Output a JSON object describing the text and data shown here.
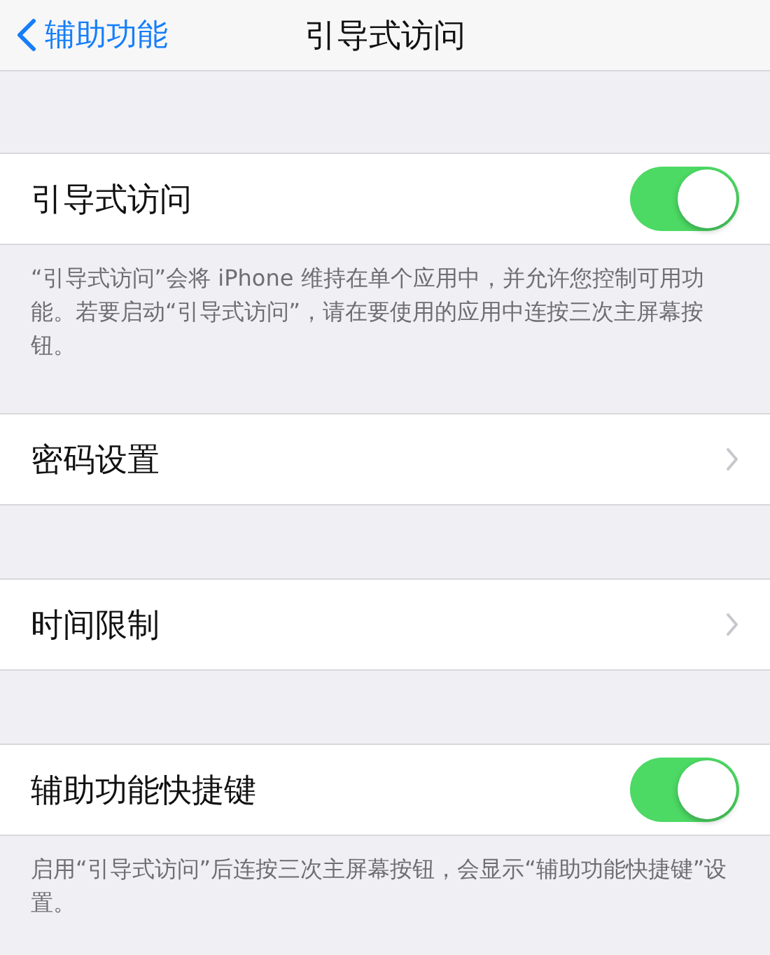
{
  "nav": {
    "back_label": "辅助功能",
    "title": "引导式访问"
  },
  "sections": [
    {
      "rows": [
        {
          "kind": "toggle",
          "label": "引导式访问",
          "on": true
        }
      ],
      "footer": "“引导式访问”会将 iPhone 维持在单个应用中，并允许您控制可用功能。若要启动“引导式访问”，请在要使用的应用中连按三次主屏幕按钮。"
    },
    {
      "rows": [
        {
          "kind": "link",
          "label": "密码设置"
        }
      ]
    },
    {
      "rows": [
        {
          "kind": "link",
          "label": "时间限制"
        }
      ]
    },
    {
      "rows": [
        {
          "kind": "toggle",
          "label": "辅助功能快捷键",
          "on": true
        }
      ],
      "footer": "启用“引导式访问”后连按三次主屏幕按钮，会显示“辅助功能快捷键”设置。"
    }
  ]
}
